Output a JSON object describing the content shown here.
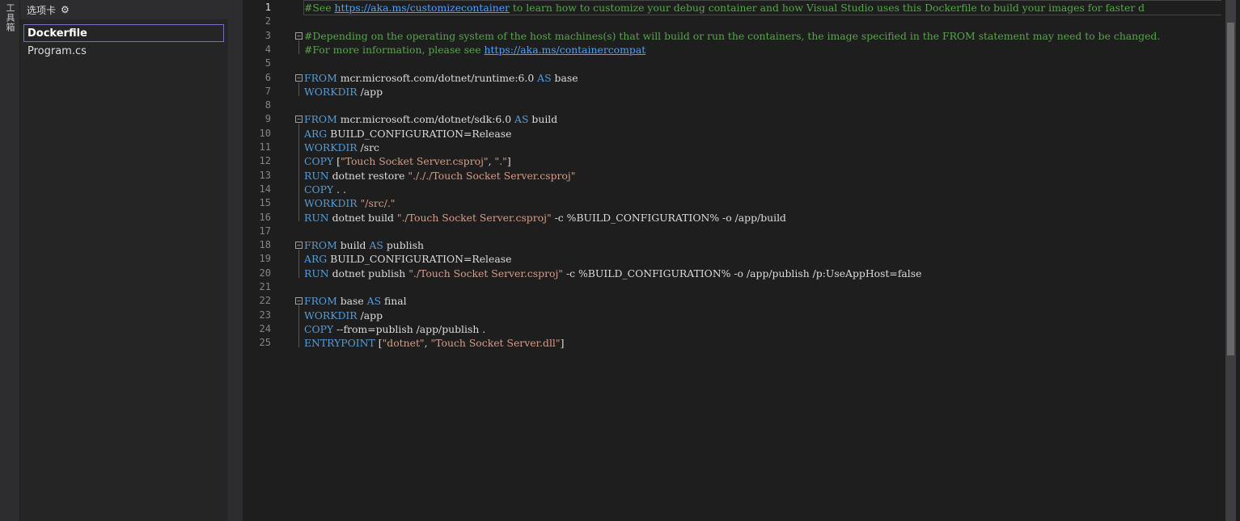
{
  "toolbox": {
    "label": "工具箱"
  },
  "tabs_panel": {
    "header": "选项卡",
    "gear_icon": "gear-icon",
    "items": [
      {
        "label": "Dockerfile",
        "active": true
      },
      {
        "label": "Program.cs",
        "active": false
      }
    ]
  },
  "editor": {
    "current_line": 1,
    "line_numbers": [
      "1",
      "2",
      "3",
      "4",
      "5",
      "6",
      "7",
      "8",
      "9",
      "10",
      "11",
      "12",
      "13",
      "14",
      "15",
      "16",
      "17",
      "18",
      "19",
      "20",
      "21",
      "22",
      "23",
      "24",
      "25"
    ],
    "lines": [
      [
        {
          "t": "#See ",
          "c": "cm"
        },
        {
          "t": "https://aka.ms/customizecontainer",
          "c": "link"
        },
        {
          "t": " to learn how to customize your debug container and how Visual Studio uses this Dockerfile to build your images for faster d",
          "c": "cm"
        }
      ],
      [],
      [
        {
          "t": "#Depending on the operating system of the host machines(s) that will build or run the containers, the image specified in the FROM statement may need to be changed.",
          "c": "cm"
        }
      ],
      [
        {
          "t": "#For more information, please see ",
          "c": "cm"
        },
        {
          "t": "https://aka.ms/containercompat",
          "c": "link"
        }
      ],
      [],
      [
        {
          "t": "FROM",
          "c": "kw"
        },
        {
          "t": " mcr.microsoft.com/dotnet/runtime:6.0 ",
          "c": ""
        },
        {
          "t": "AS",
          "c": "kw"
        },
        {
          "t": " base",
          "c": ""
        }
      ],
      [
        {
          "t": "WORKDIR",
          "c": "kw"
        },
        {
          "t": " /app",
          "c": ""
        }
      ],
      [],
      [
        {
          "t": "FROM",
          "c": "kw"
        },
        {
          "t": " mcr.microsoft.com/dotnet/sdk:6.0 ",
          "c": ""
        },
        {
          "t": "AS",
          "c": "kw"
        },
        {
          "t": " build",
          "c": ""
        }
      ],
      [
        {
          "t": "ARG",
          "c": "kw"
        },
        {
          "t": " BUILD_CONFIGURATION=Release",
          "c": ""
        }
      ],
      [
        {
          "t": "WORKDIR",
          "c": "kw"
        },
        {
          "t": " /src",
          "c": ""
        }
      ],
      [
        {
          "t": "COPY",
          "c": "kw"
        },
        {
          "t": " [",
          "c": ""
        },
        {
          "t": "\"Touch Socket Server.csproj\"",
          "c": "str"
        },
        {
          "t": ", ",
          "c": ""
        },
        {
          "t": "\".\"",
          "c": "str"
        },
        {
          "t": "]",
          "c": ""
        }
      ],
      [
        {
          "t": "RUN",
          "c": "kw"
        },
        {
          "t": " dotnet restore ",
          "c": ""
        },
        {
          "t": "\"./././Touch Socket Server.csproj\"",
          "c": "str"
        }
      ],
      [
        {
          "t": "COPY",
          "c": "kw"
        },
        {
          "t": " . .",
          "c": ""
        }
      ],
      [
        {
          "t": "WORKDIR",
          "c": "kw"
        },
        {
          "t": " ",
          "c": ""
        },
        {
          "t": "\"/src/.\"",
          "c": "str"
        }
      ],
      [
        {
          "t": "RUN",
          "c": "kw"
        },
        {
          "t": " dotnet build ",
          "c": ""
        },
        {
          "t": "\"./Touch Socket Server.csproj\"",
          "c": "str"
        },
        {
          "t": " -c %BUILD_CONFIGURATION% -o /app/build",
          "c": ""
        }
      ],
      [],
      [
        {
          "t": "FROM",
          "c": "kw"
        },
        {
          "t": " build ",
          "c": ""
        },
        {
          "t": "AS",
          "c": "kw"
        },
        {
          "t": " publish",
          "c": ""
        }
      ],
      [
        {
          "t": "ARG",
          "c": "kw"
        },
        {
          "t": " BUILD_CONFIGURATION=Release",
          "c": ""
        }
      ],
      [
        {
          "t": "RUN",
          "c": "kw"
        },
        {
          "t": " dotnet publish ",
          "c": ""
        },
        {
          "t": "\"./Touch Socket Server.csproj\"",
          "c": "str"
        },
        {
          "t": " -c %BUILD_CONFIGURATION% -o /app/publish /p:UseAppHost=false",
          "c": ""
        }
      ],
      [],
      [
        {
          "t": "FROM",
          "c": "kw"
        },
        {
          "t": " base ",
          "c": ""
        },
        {
          "t": "AS",
          "c": "kw"
        },
        {
          "t": " final",
          "c": ""
        }
      ],
      [
        {
          "t": "WORKDIR",
          "c": "kw"
        },
        {
          "t": " /app",
          "c": ""
        }
      ],
      [
        {
          "t": "COPY",
          "c": "kw"
        },
        {
          "t": " --from=publish /app/publish .",
          "c": ""
        }
      ],
      [
        {
          "t": "ENTRYPOINT",
          "c": "kw"
        },
        {
          "t": " [",
          "c": ""
        },
        {
          "t": "\"dotnet\"",
          "c": "str"
        },
        {
          "t": ", ",
          "c": ""
        },
        {
          "t": "\"Touch Socket Server.dll\"",
          "c": "str"
        },
        {
          "t": "]",
          "c": ""
        }
      ]
    ]
  }
}
